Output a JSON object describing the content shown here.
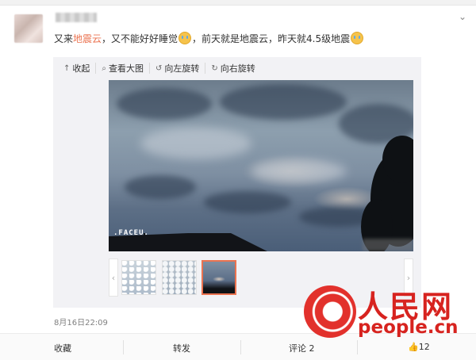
{
  "post": {
    "text_before": "又来",
    "highlight": "地震云",
    "text_middle": "，又不能好好睡觉",
    "text_after1": "，前天就是地震云，昨天就4.5级地震",
    "date": "8月16日22:09"
  },
  "toolbar": {
    "collapse": "收起",
    "view_large": "查看大图",
    "rotate_left": "向左旋转",
    "rotate_right": "向右旋转"
  },
  "photo": {
    "watermark": ".FACEU."
  },
  "actions": {
    "favorite": "收藏",
    "repost": "转发",
    "comment": "评论 2",
    "like_count": "12"
  },
  "logo": {
    "cn": "人民网",
    "en": "people.cn"
  },
  "icons": {
    "chevron": "chevron-down-icon",
    "emoji": "crying-emoji-icon",
    "collapse": "arrow-up-icon",
    "search": "search-icon",
    "rotate_left": "rotate-left-icon",
    "rotate_right": "rotate-right-icon",
    "like": "thumbs-up-icon",
    "prev": "chevron-left-icon",
    "next": "chevron-right-icon"
  },
  "colors": {
    "highlight": "#eb7350",
    "logo_red": "#d7231f",
    "selected_border": "#eb7350"
  }
}
